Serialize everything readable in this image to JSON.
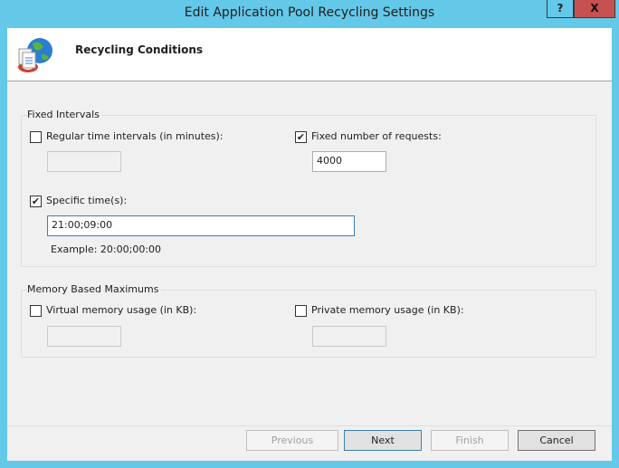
{
  "window": {
    "title": "Edit Application Pool Recycling Settings",
    "help_label": "?",
    "close_label": "X"
  },
  "header": {
    "title": "Recycling Conditions",
    "icon": "app-pool-recycle-icon"
  },
  "fixed_intervals": {
    "legend": "Fixed Intervals",
    "regular_time": {
      "label": "Regular time intervals (in minutes):",
      "checked": false,
      "value": ""
    },
    "fixed_requests": {
      "label": "Fixed number of requests:",
      "checked": true,
      "value": "4000"
    },
    "specific_times": {
      "label": "Specific time(s):",
      "checked": true,
      "value": "21:00;09:00",
      "example": "Example: 20:00;00:00"
    }
  },
  "memory": {
    "legend": "Memory Based Maximums",
    "virtual": {
      "label": "Virtual memory usage (in KB):",
      "checked": false,
      "value": ""
    },
    "private": {
      "label": "Private memory usage (in KB):",
      "checked": false,
      "value": ""
    }
  },
  "buttons": {
    "previous": "Previous",
    "next": "Next",
    "finish": "Finish",
    "cancel": "Cancel"
  },
  "check_glyph": "✔"
}
